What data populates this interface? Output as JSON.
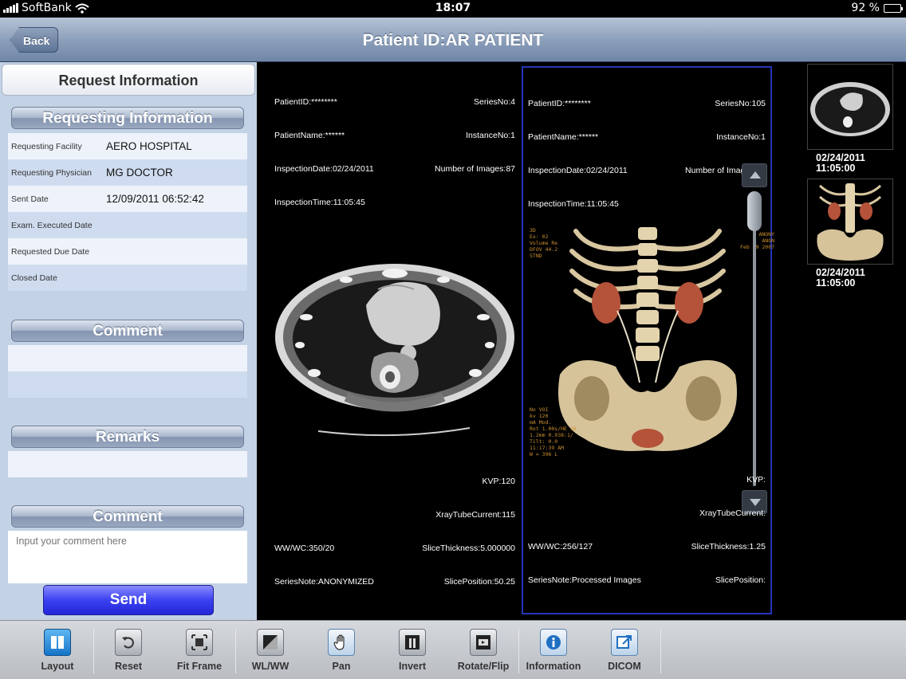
{
  "status_bar": {
    "carrier": "SoftBank",
    "time": "18:07",
    "battery": "92 %",
    "battery_level": 0.92
  },
  "nav": {
    "back_label": "Back",
    "title": "Patient ID:AR PATIENT"
  },
  "panel": {
    "header": "Request Information",
    "requesting_section": "Requesting Information",
    "rows": [
      {
        "label": "Requesting Facility",
        "value": "AERO HOSPITAL"
      },
      {
        "label": "Requesting Physician",
        "value": "MG DOCTOR"
      },
      {
        "label": "Sent Date",
        "value": "12/09/2011 06:52:42"
      },
      {
        "label": "Exam. Executed Date",
        "value": ""
      },
      {
        "label": "Requested Due Date",
        "value": ""
      },
      {
        "label": "Closed Date",
        "value": ""
      }
    ],
    "comment_section": "Comment",
    "remarks_section": "Remarks",
    "comment_input_section": "Comment",
    "comment_placeholder": "Input your comment here",
    "send_label": "Send"
  },
  "viewers": [
    {
      "top_left": [
        "PatientID:********",
        "PatientName:******",
        "InspectionDate:02/24/2011",
        "InspectionTime:11:05:45"
      ],
      "top_right": [
        "SeriesNo:4",
        "InstanceNo:1",
        "Number of Images:87"
      ],
      "bottom_left": [
        "WW/WC:350/20",
        "SeriesNote:ANONYMIZED"
      ],
      "bottom_right": [
        "KVP:120",
        "XrayTubeCurrent:115",
        "SliceThickness:5.000000",
        "SlicePosition:50.25"
      ]
    },
    {
      "top_left": [
        "PatientID:********",
        "PatientName:******",
        "InspectionDate:02/24/2011",
        "InspectionTime:11:05:45"
      ],
      "top_right": [
        "SeriesNo:105",
        "InstanceNo:1",
        "Number of Images:36"
      ],
      "bottom_left": [
        "WW/WC:256/127",
        "SeriesNote:Processed Images"
      ],
      "bottom_right": [
        "KVP:",
        "XrayTubeCurrent:",
        "SliceThickness:1.25",
        "SlicePosition:"
      ]
    }
  ],
  "thumbnails": [
    {
      "date": "02/24/2011",
      "time": "11:05:00"
    },
    {
      "date": "02/24/2011",
      "time": "11:05:00"
    }
  ],
  "toolbar": [
    {
      "label": "Layout",
      "icon": "layout-icon"
    },
    {
      "label": "Reset",
      "icon": "reset-icon"
    },
    {
      "label": "Fit Frame",
      "icon": "fit-frame-icon"
    },
    {
      "label": "WL/WW",
      "icon": "window-level-icon"
    },
    {
      "label": "Pan",
      "icon": "pan-hand-icon"
    },
    {
      "label": "Invert",
      "icon": "invert-icon"
    },
    {
      "label": "Rotate/Flip",
      "icon": "rotate-flip-icon"
    },
    {
      "label": "Information",
      "icon": "information-icon"
    },
    {
      "label": "DICOM",
      "icon": "dicom-icon"
    }
  ],
  "colors": {
    "nav_bar": "#8da0bb",
    "panel_bg": "#c4d2e6",
    "send_button": "#3c42f0",
    "selected_viewer_border": "#2435b8",
    "vr_overlay_text": "#c98e2f"
  }
}
